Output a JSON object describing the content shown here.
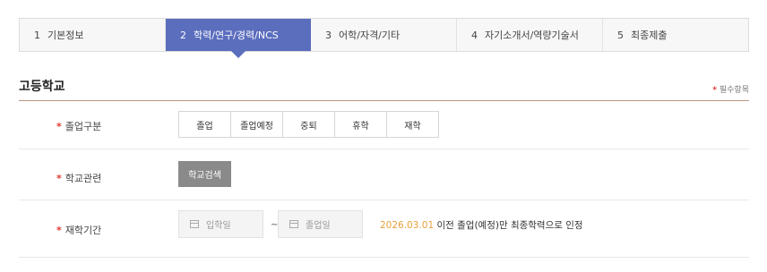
{
  "steps": [
    {
      "num": "1",
      "label": "기본정보"
    },
    {
      "num": "2",
      "label": "학력/연구/경력/NCS"
    },
    {
      "num": "3",
      "label": "어학/자격/기타"
    },
    {
      "num": "4",
      "label": "자기소개서/역량기술서"
    },
    {
      "num": "5",
      "label": "최종제출"
    }
  ],
  "active_step": 2,
  "section": {
    "title": "고등학교",
    "required_star": "*",
    "required_label": "필수항목"
  },
  "rows": {
    "graduation": {
      "label": "졸업구분",
      "options": [
        "졸업",
        "졸업예정",
        "중퇴",
        "휴학",
        "재학"
      ]
    },
    "school": {
      "label": "학교관련",
      "search_button": "학교검색"
    },
    "period": {
      "label": "재학기간",
      "start_placeholder": "입학일",
      "end_placeholder": "졸업일",
      "separator": "~",
      "note_date": "2026.03.01",
      "note_text": " 이전 졸업(예정)만 최종학력으로 인정"
    }
  },
  "colors": {
    "active_step": "#5b6dbd",
    "required_star": "#e0372f",
    "highlight_date": "#e6a03b",
    "search_button": "#8a8a8a"
  }
}
